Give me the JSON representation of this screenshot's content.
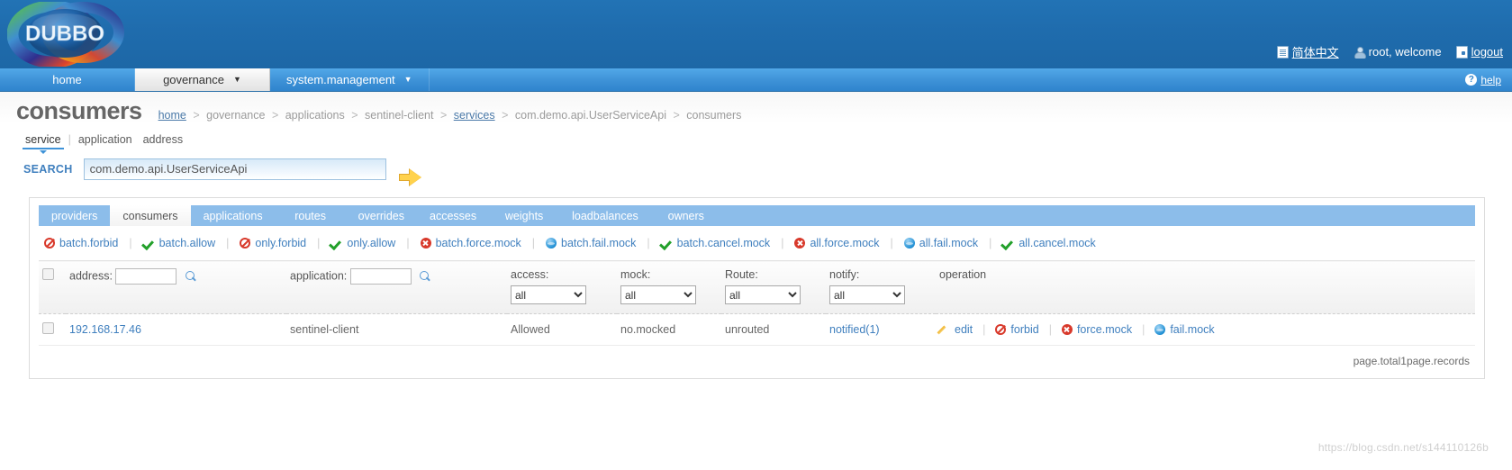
{
  "header": {
    "logo_text": "DUBBO",
    "language_label": "简体中文",
    "user_label": "root, welcome",
    "logout_label": "logout",
    "language_icon": "document-icon",
    "user_icon": "user-icon",
    "logout_icon": "door-exit-icon"
  },
  "nav": {
    "tabs": [
      {
        "label": "home",
        "caret": "",
        "active": false
      },
      {
        "label": "governance",
        "caret": "▼",
        "active": true
      },
      {
        "label": "system.management",
        "caret": "▼",
        "active": false
      }
    ],
    "help_label": "help",
    "help_icon": "question-circle-icon"
  },
  "page": {
    "title": "consumers",
    "breadcrumb": [
      {
        "label": "home",
        "link": true
      },
      {
        "label": "governance",
        "link": false
      },
      {
        "label": "applications",
        "link": false
      },
      {
        "label": "sentinel-client",
        "link": false
      },
      {
        "label": "services",
        "link": true
      },
      {
        "label": "com.demo.api.UserServiceApi",
        "link": false
      },
      {
        "label": "consumers",
        "link": false
      }
    ],
    "breadcrumb_separator": ">"
  },
  "subtabs": [
    {
      "label": "service",
      "active": true
    },
    {
      "label": "application",
      "active": false
    },
    {
      "label": "address",
      "active": false
    }
  ],
  "subtab_divider": "|",
  "search": {
    "label": "SEARCH",
    "value": "com.demo.api.UserServiceApi",
    "placeholder": "",
    "go_icon": "arrow-right-icon"
  },
  "panel": {
    "tabs": [
      {
        "label": "providers",
        "active": false
      },
      {
        "label": "consumers",
        "active": true
      },
      {
        "label": "applications",
        "active": false
      },
      {
        "label": "routes",
        "active": false
      },
      {
        "label": "overrides",
        "active": false
      },
      {
        "label": "accesses",
        "active": false
      },
      {
        "label": "weights",
        "active": false
      },
      {
        "label": "loadbalances",
        "active": false
      },
      {
        "label": "owners",
        "active": false
      }
    ],
    "actions": [
      {
        "label": "batch.forbid",
        "icon": "forbid-icon"
      },
      {
        "label": "batch.allow",
        "icon": "check-icon"
      },
      {
        "label": "only.forbid",
        "icon": "forbid-icon"
      },
      {
        "label": "only.allow",
        "icon": "check-icon"
      },
      {
        "label": "batch.force.mock",
        "icon": "error-circle-icon"
      },
      {
        "label": "batch.fail.mock",
        "icon": "blue-sphere-icon"
      },
      {
        "label": "batch.cancel.mock",
        "icon": "check-icon"
      },
      {
        "label": "all.force.mock",
        "icon": "error-circle-icon"
      },
      {
        "label": "all.fail.mock",
        "icon": "blue-sphere-icon"
      },
      {
        "label": "all.cancel.mock",
        "icon": "check-icon"
      }
    ],
    "action_separator": "|",
    "table": {
      "headers": {
        "address_label": "address:",
        "application_label": "application:",
        "access_label": "access:",
        "mock_label": "mock:",
        "route_label": "Route:",
        "notify_label": "notify:",
        "operation_label": "operation"
      },
      "filters": {
        "address_value": "",
        "application_value": "",
        "access_selected": "all",
        "mock_selected": "all",
        "route_selected": "all",
        "notify_selected": "all",
        "options": [
          "all"
        ]
      },
      "rows": [
        {
          "address": "192.168.17.46",
          "application": "sentinel-client",
          "access": "Allowed",
          "mock": "no.mocked",
          "route": "unrouted",
          "notify": "notified(1)",
          "operations": [
            {
              "label": "edit",
              "icon": "pencil-icon"
            },
            {
              "label": "forbid",
              "icon": "forbid-icon"
            },
            {
              "label": "force.mock",
              "icon": "error-circle-icon"
            },
            {
              "label": "fail.mock",
              "icon": "blue-sphere-icon"
            }
          ]
        }
      ],
      "operation_separator": "|"
    },
    "pager_text": "page.total1page.records"
  },
  "watermark": "https://blog.csdn.net/s144110126b"
}
